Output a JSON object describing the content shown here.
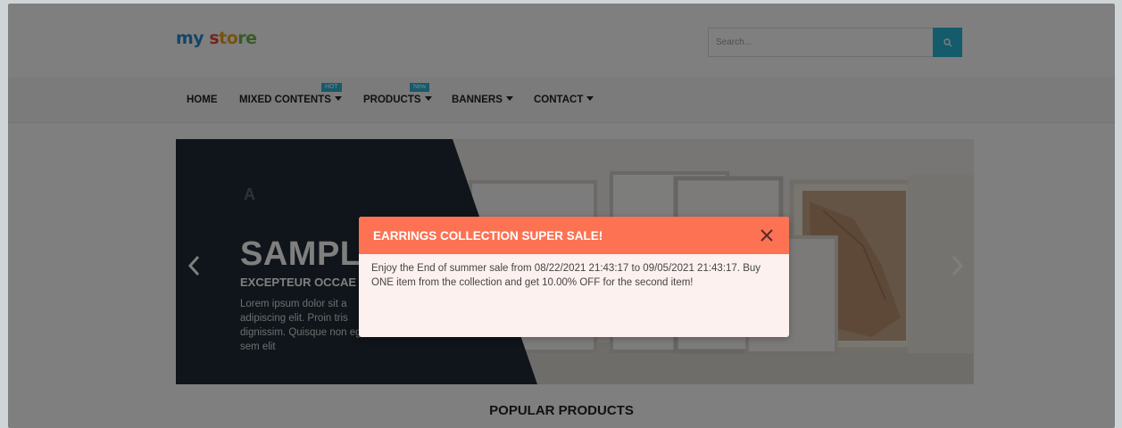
{
  "header": {
    "logo": {
      "part1": "my ",
      "part2": "s",
      "part3": "to",
      "part4": "re"
    },
    "search": {
      "placeholder": "Search..."
    }
  },
  "nav": {
    "items": [
      {
        "label": "HOME",
        "dropdown": false
      },
      {
        "label": "MIXED CONTENTS",
        "dropdown": true,
        "badge": "HOT"
      },
      {
        "label": "PRODUCTS",
        "dropdown": true,
        "badge": "New"
      },
      {
        "label": "BANNERS",
        "dropdown": true
      },
      {
        "label": "CONTACT",
        "dropdown": true
      }
    ]
  },
  "slider": {
    "mark": "A",
    "title": "SAMPL",
    "subtitle": "EXCEPTEUR OCCAE",
    "text": "Lorem ipsum dolor sit a adipiscing elit. Proin tris dignissim. Quisque non egestas sem elit"
  },
  "section": {
    "popular_title": "POPULAR PRODUCTS"
  },
  "modal": {
    "title": "EARRINGS COLLECTION SUPER SALE!",
    "body": "Enjoy the End of summer sale from 08/22/2021 21:43:17 to 09/05/2021 21:43:17. Buy ONE item from the collection and get 10.00% OFF for the second item!"
  },
  "colors": {
    "accent": "#29b6d8",
    "modal_header": "#fc7253",
    "modal_body": "#fdf1ef",
    "slide_dark": "#1f2b35"
  },
  "icons": {
    "search": "search-icon",
    "close": "close-icon",
    "prev": "chevron-left-icon",
    "next": "chevron-right-icon"
  }
}
